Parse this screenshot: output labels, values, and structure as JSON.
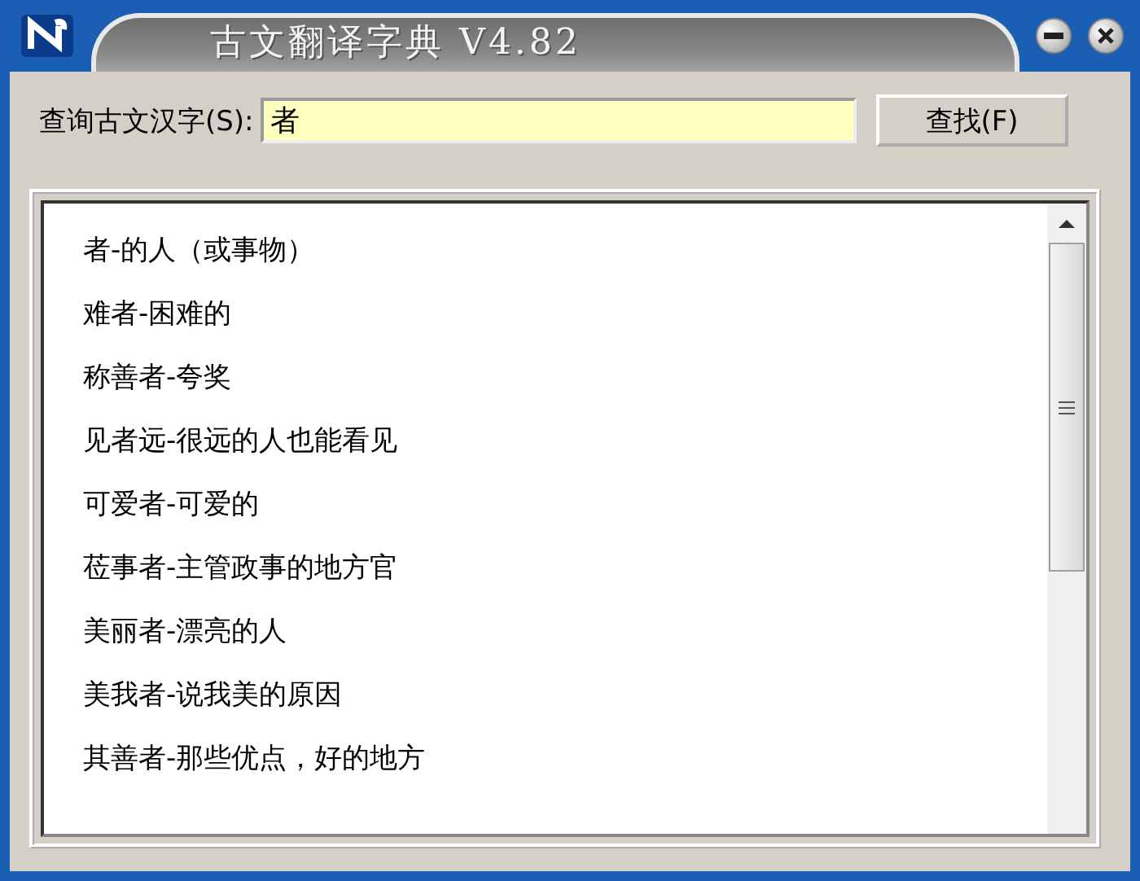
{
  "window": {
    "title": "古文翻译字典 V4.82"
  },
  "search": {
    "label": "查询古文汉字(S):",
    "value": "者",
    "button": "查找(F)"
  },
  "results": [
    {
      "text": "者-的人（或事物）"
    },
    {
      "text": "难者-困难的"
    },
    {
      "text": "称善者-夸奖"
    },
    {
      "text": "见者远-很远的人也能看见"
    },
    {
      "text": "可爱者-可爱的"
    },
    {
      "text": "莅事者-主管政事的地方官"
    },
    {
      "text": "美丽者-漂亮的人"
    },
    {
      "text": "美我者-说我美的原因"
    },
    {
      "text": "其善者-那些优点，好的地方"
    }
  ]
}
